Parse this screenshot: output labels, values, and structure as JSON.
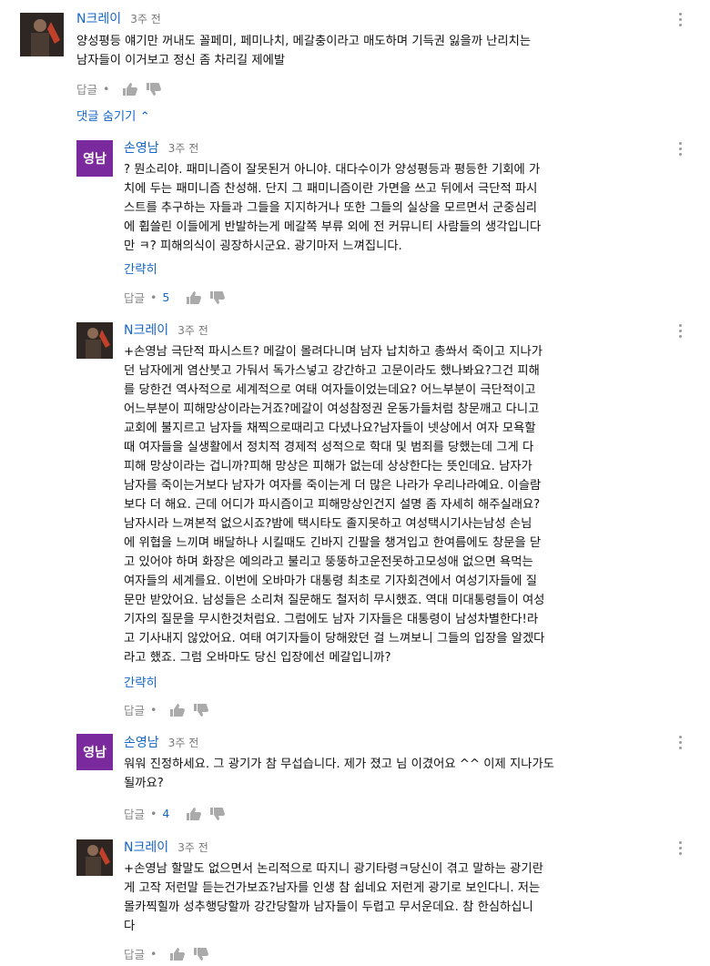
{
  "comments": [
    {
      "author": "N크레이",
      "time": "3주 전",
      "lines": [
        "양성평등 얘기만 꺼내도 꼴페미, 페미나치, 메갈충이라고 매도하며 기득권 잃을까 난리치는",
        "남자들이 이거보고 정신 좀 차리길 제에발"
      ],
      "reply_label": "답글",
      "likes": "",
      "show_less": ""
    },
    {
      "author": "손영남",
      "avatar_text": "영남",
      "time": "3주 전",
      "lines": [
        "? 뭔소리야. 패미니즘이 잘못된거 아니야. 대다수이가 양성평등과 평등한 기회에 가",
        "치에 두는 패미니즘 찬성해. 단지 그 패미니즘이란 가면을 쓰고 뒤에서 극단적 파시",
        "스트를 추구하는 자들과 그들을 지지하거나 또한 그들의 실상을 모르면서 군중심리",
        "에 휩쓸린 이들에게 반발하는게 메갈쪽 부류 외에 전 커뮤니티 사람들의 생각입니다",
        "만 ㅋ? 피해의식이 굉장하시군요. 광기마저 느껴집니다."
      ],
      "show_less": "간략히",
      "reply_label": "답글",
      "likes": "5"
    },
    {
      "author": "N크레이",
      "time": "3주 전",
      "lines": [
        "+손영남 극단적 파시스트? 메갈이 몰려다니며 남자 납치하고 총쏴서 죽이고 지나가",
        "던 남자에게 염산붓고 가둬서 독가스넣고 강간하고 고문이라도 했나봐요?그건 피해",
        "를 당한건 역사적으로 세계적으로 여태 여자들이었는데요? 어느부분이 극단적이고",
        "어느부분이 피해망상이라는거죠?메갈이 여성참정권 운동가들처럼 창문깨고 다니고",
        "교회에 불지르고 남자들 채찍으로때리고 다녔나요?남자들이 넷상에서 여자 모욕할",
        "때 여자들을 실생활에서 정치적 경제적 성적으로 학대 및 범죄를 당했는데 그게 다",
        "피해 망상이라는 겁니까?피해 망상은 피해가 없는데 상상한다는 뜻인데요. 남자가",
        "남자를 죽이는거보다 남자가 여자를 죽이는게 더 많은 나라가 우리나라예요. 이슬람",
        "보다 더 해요. 근데 어디가 파시즘이고 피해망상인건지 설명 좀 자세히 해주실래요?",
        "남자시라 느껴본적 없으시죠?밤에 택시타도 졸지못하고 여성택시기사는남성 손님",
        "에 위협을 느끼며 배달하나 시킬때도 긴바지 긴팔을 챙겨입고 한여름에도 창문을 닫",
        "고 있어야 하며 화장은 예의라고 불리고 뚱뚱하고운전못하고모성애 없으면 욕먹는",
        "여자들의 세계를요. 이번에 오바마가 대통령 최초로 기자회견에서 여성기자들에 질",
        "문만 받았어요. 남성들은 소리쳐 질문해도 철저히 무시했죠. 역대 미대통령들이 여성",
        "기자의 질문을 무시한것처럼요. 그럼에도 남자 기자들은 대통령이 남성차별한다!라",
        "고 기사내지 않았어요. 여태 여기자들이 당해왔던 걸 느껴보니 그들의 입장을 알겠다",
        "라고 했죠. 그럼 오바마도 당신 입장에선 메갈입니까?"
      ],
      "show_less": "간략히",
      "reply_label": "답글",
      "likes": ""
    },
    {
      "author": "손영남",
      "avatar_text": "영남",
      "time": "3주 전",
      "lines": [
        "워워 진정하세요. 그 광기가 참 무섭습니다. 제가 졌고 님 이겼어요 ^^ 이제 지나가도",
        "될까요?"
      ],
      "show_less": "",
      "reply_label": "답글",
      "likes": "4"
    },
    {
      "author": "N크레이",
      "time": "3주 전",
      "lines": [
        "+손영남 할말도 없으면서 논리적으로 따지니 광기타령ㅋ당신이 겪고 말하는 광기란",
        "게 고작 저런말 듣는건가보죠?남자를 인생 참 쉽네요 저런게 광기로 보인다니. 저는",
        "몰카찍힐까 성추행당할까 강간당할까 남자들이 두렵고 무서운데요. 참 한심하십니",
        "다"
      ],
      "show_less": "",
      "reply_label": "답글",
      "likes": ""
    }
  ],
  "hide_replies": "댓글 숨기기",
  "colors": {
    "link": "#1566c9",
    "avatar_purple": "#7b2a9e",
    "meta": "#8a8a8a"
  }
}
